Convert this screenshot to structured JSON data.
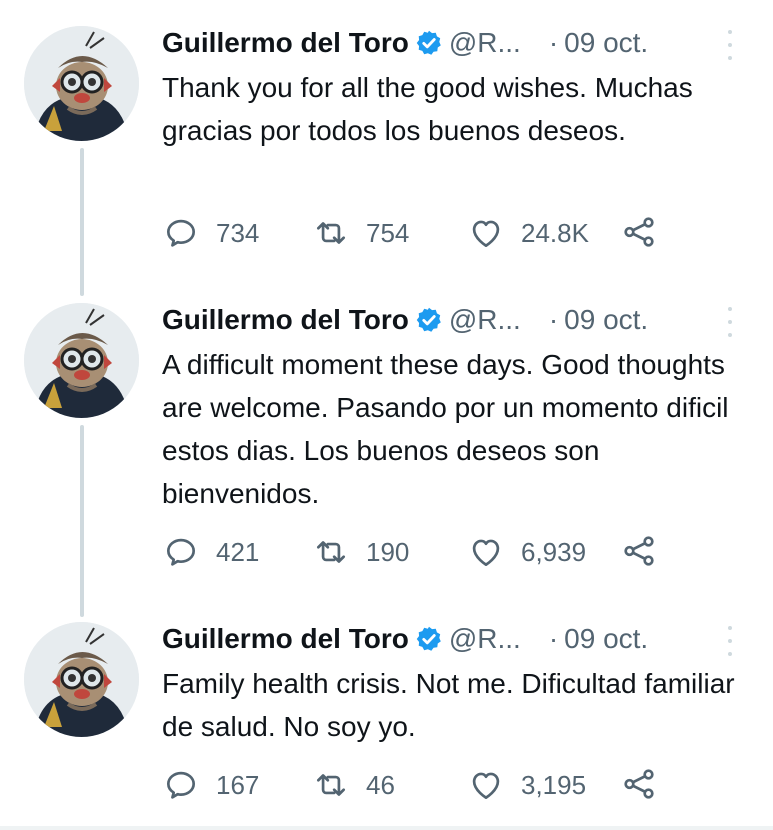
{
  "tweets": [
    {
      "author_name": "Guillermo del Toro",
      "handle": "@R...",
      "separator": "·",
      "date": "09 oct.",
      "text": "Thank you for all the good wishes. Muchas gracias por todos los buenos deseos.",
      "replies": "734",
      "retweets": "754",
      "likes": "24.8K"
    },
    {
      "author_name": "Guillermo del Toro",
      "handle": "@R...",
      "separator": "·",
      "date": "09 oct.",
      "text": "A difficult moment these days. Good thoughts are welcome. Pasando por un momento dificil estos dias. Los buenos deseos son bienvenidos.",
      "replies": "421",
      "retweets": "190",
      "likes": "6,939"
    },
    {
      "author_name": "Guillermo del Toro",
      "handle": "@R...",
      "separator": "·",
      "date": "09 oct.",
      "text": "Family health crisis. Not me. Dificultad familiar de salud. No soy yo.",
      "replies": "167",
      "retweets": "46",
      "likes": "3,195"
    }
  ],
  "icons": {
    "verified": "verified-badge-icon",
    "reply": "reply-bubble-icon",
    "retweet": "retweet-icon",
    "like": "heart-icon",
    "share": "share-icon",
    "more": "more-options-icon"
  },
  "colors": {
    "text": "#0f1419",
    "secondary": "#536471",
    "verified": "#1d9bf0",
    "thread_line": "#cfd9de"
  }
}
